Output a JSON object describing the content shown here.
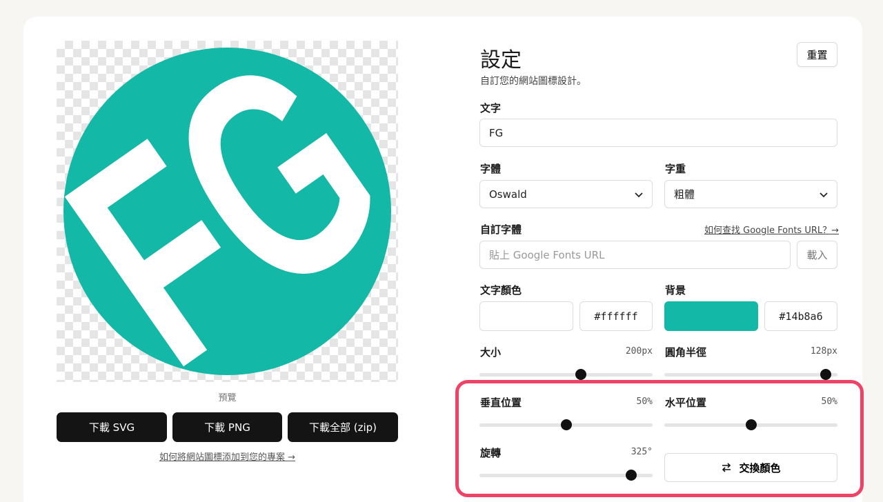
{
  "preview": {
    "logo_text": "FG",
    "text_color": "#ffffff",
    "background_color": "#14b8a6",
    "rotation_deg": 325,
    "label": "預覽"
  },
  "downloads": {
    "svg_label": "下載 SVG",
    "png_label": "下載 PNG",
    "zip_label": "下載全部 (zip)",
    "help_link": "如何將網站圖標添加到您的專案 →"
  },
  "settings": {
    "title": "設定",
    "subtitle": "自訂您的網站圖標設計。",
    "reset_label": "重置",
    "text": {
      "label": "文字",
      "value": "FG"
    },
    "font": {
      "label": "字體",
      "value": "Oswald"
    },
    "weight": {
      "label": "字重",
      "value": "粗體"
    },
    "custom_font": {
      "label": "自訂字體",
      "help_link": "如何查找 Google Fonts URL？→",
      "placeholder": "貼上 Google Fonts URL",
      "load_label": "載入"
    },
    "text_color": {
      "label": "文字顏色",
      "value": "#ffffff",
      "swatch": "#ffffff"
    },
    "background": {
      "label": "背景",
      "value": "#14b8a6",
      "swatch": "#14b8a6"
    },
    "size": {
      "label": "大小",
      "value": "200px",
      "fraction": 0.59
    },
    "radius": {
      "label": "圓角半徑",
      "value": "128px",
      "fraction": 0.96
    },
    "vertical": {
      "label": "垂直位置",
      "value": "50%",
      "fraction": 0.5
    },
    "horizontal": {
      "label": "水平位置",
      "value": "50%",
      "fraction": 0.5
    },
    "rotation": {
      "label": "旋轉",
      "value": "325°",
      "fraction": 0.9
    },
    "swap_label": "交換顏色"
  },
  "colors": {
    "accent": "#14b8a6",
    "highlight": "#ef4267",
    "button_dark": "#141414"
  }
}
